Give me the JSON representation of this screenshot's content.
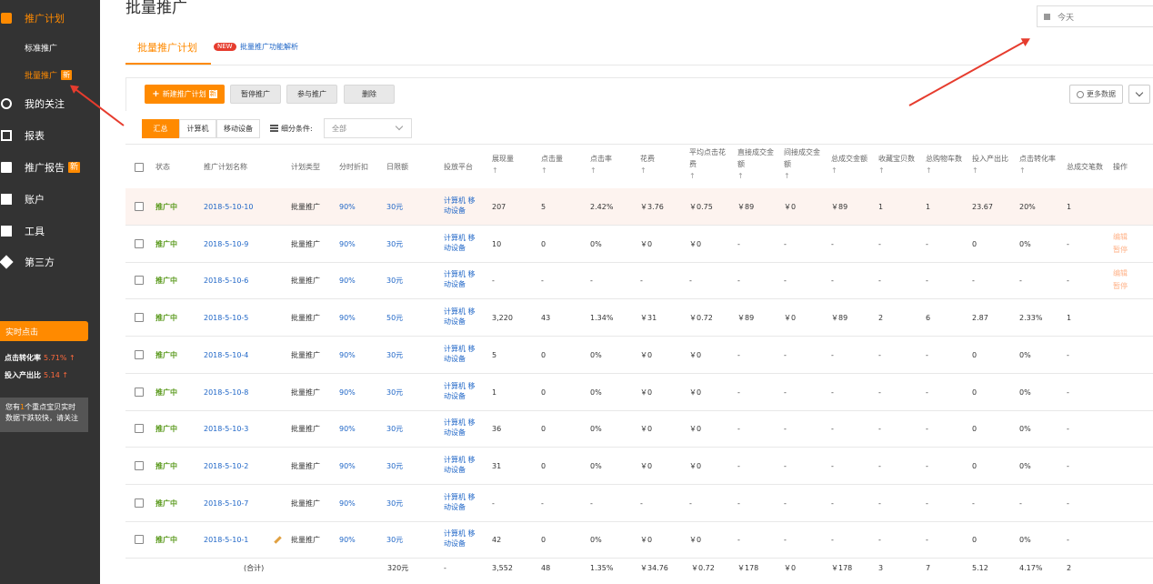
{
  "sidebar": {
    "items": [
      {
        "label": "推广计划",
        "icon": "briefcase-icon"
      },
      {
        "label": "我的关注",
        "icon": "heart-icon"
      },
      {
        "label": "报表",
        "icon": "report-icon"
      },
      {
        "label": "推广报告",
        "icon": "bag-icon",
        "badge": "新"
      },
      {
        "label": "账户",
        "icon": "id-card-icon"
      },
      {
        "label": "工具",
        "icon": "toolbox-icon"
      },
      {
        "label": "第三方",
        "icon": "diamond-icon"
      }
    ],
    "sub_items": [
      {
        "label": "标准推广"
      },
      {
        "label": "批量推广",
        "badge": "新"
      }
    ],
    "realtime": {
      "title": "实时点击",
      "ctr_label": "点击转化率",
      "ctr_value": "5.71% ↑",
      "roi_label": "投入产出比",
      "roi_value": "5.14 ↑",
      "note_prefix": "您有",
      "note_count": "1",
      "note_line1_suffix": "个重点宝贝实时",
      "note_line2": "数据下跌较快，请关注"
    }
  },
  "header": {
    "title": "批量推广",
    "date_value": "今天"
  },
  "tabs": {
    "plan": "批量推广计划",
    "new_tag": "NEW",
    "feature_link": "批量推广功能解析"
  },
  "toolbar": {
    "new_plan": "新建推广计划",
    "new_plan_badge": "新",
    "pause": "暂停推广",
    "join": "参与推广",
    "delete": "删除",
    "more_data": "更多数据"
  },
  "filters": {
    "segments": [
      "汇总",
      "计算机",
      "移动设备"
    ],
    "condition_label": "细分条件:",
    "condition_value": "全部"
  },
  "colors": {
    "accent": "#ff8a00",
    "link": "#1f66c7",
    "status": "#5b9a1e",
    "sidebar": "#333333"
  },
  "table": {
    "headers": [
      {
        "label": "状态"
      },
      {
        "label": "推广计划名称"
      },
      {
        "label": "计划类型"
      },
      {
        "label": "分时折扣"
      },
      {
        "label": "日限额"
      },
      {
        "label": "投放平台"
      },
      {
        "label": "展现量",
        "arrow": "↑"
      },
      {
        "label": "点击量",
        "arrow": "↑"
      },
      {
        "label": "点击率",
        "arrow": "↑"
      },
      {
        "label": "花费",
        "arrow": "↑"
      },
      {
        "label": "平均点击花",
        "label2": "费",
        "arrow": "↑"
      },
      {
        "label": "直接成交金",
        "label2": "额",
        "arrow": "↑"
      },
      {
        "label": "间接成交金",
        "label2": "额",
        "arrow": "↑"
      },
      {
        "label": "总成交金额",
        "arrow": "↑"
      },
      {
        "label": "收藏宝贝数",
        "arrow": "↑"
      },
      {
        "label": "总购物车数",
        "arrow": "↑"
      },
      {
        "label": "投入产出比",
        "arrow": "↑"
      },
      {
        "label": "点击转化率",
        "arrow": "↑"
      },
      {
        "label": "总成交笔数"
      },
      {
        "label": "操作"
      }
    ],
    "platform_line1": "计算机 移",
    "platform_line2": "动设备",
    "rows": [
      {
        "status": "推广中",
        "name": "2018-5-10-10",
        "type": "批量推广",
        "discount": "90%",
        "limit": "30元",
        "impr": "207",
        "clicks": "5",
        "ctr": "2.42%",
        "cost": "￥3.76",
        "cpc": "￥0.75",
        "direct": "￥89",
        "indirect": "￥0",
        "total_amt": "￥89",
        "fav": "1",
        "cart": "1",
        "roi": "23.67",
        "cvr": "20%",
        "orders": "1",
        "op1": "",
        "op2": "",
        "highlight": true
      },
      {
        "status": "推广中",
        "name": "2018-5-10-9",
        "type": "批量推广",
        "discount": "90%",
        "limit": "30元",
        "impr": "10",
        "clicks": "0",
        "ctr": "0%",
        "cost": "￥0",
        "cpc": "￥0",
        "direct": "-",
        "indirect": "-",
        "total_amt": "-",
        "fav": "-",
        "cart": "-",
        "roi": "0",
        "cvr": "0%",
        "orders": "-",
        "op1": "编辑",
        "op2": "暂停"
      },
      {
        "status": "推广中",
        "name": "2018-5-10-6",
        "type": "批量推广",
        "discount": "90%",
        "limit": "30元",
        "impr": "-",
        "clicks": "-",
        "ctr": "-",
        "cost": "-",
        "cpc": "-",
        "direct": "-",
        "indirect": "-",
        "total_amt": "-",
        "fav": "-",
        "cart": "-",
        "roi": "-",
        "cvr": "-",
        "orders": "-",
        "op1": "编辑",
        "op2": "暂停"
      },
      {
        "status": "推广中",
        "name": "2018-5-10-5",
        "type": "批量推广",
        "discount": "90%",
        "limit": "50元",
        "impr": "3,220",
        "clicks": "43",
        "ctr": "1.34%",
        "cost": "￥31",
        "cpc": "￥0.72",
        "direct": "￥89",
        "indirect": "￥0",
        "total_amt": "￥89",
        "fav": "2",
        "cart": "6",
        "roi": "2.87",
        "cvr": "2.33%",
        "orders": "1",
        "op1": "",
        "op2": ""
      },
      {
        "status": "推广中",
        "name": "2018-5-10-4",
        "type": "批量推广",
        "discount": "90%",
        "limit": "30元",
        "impr": "5",
        "clicks": "0",
        "ctr": "0%",
        "cost": "￥0",
        "cpc": "￥0",
        "direct": "-",
        "indirect": "-",
        "total_amt": "-",
        "fav": "-",
        "cart": "-",
        "roi": "0",
        "cvr": "0%",
        "orders": "-",
        "op1": "",
        "op2": ""
      },
      {
        "status": "推广中",
        "name": "2018-5-10-8",
        "type": "批量推广",
        "discount": "90%",
        "limit": "30元",
        "impr": "1",
        "clicks": "0",
        "ctr": "0%",
        "cost": "￥0",
        "cpc": "￥0",
        "direct": "-",
        "indirect": "-",
        "total_amt": "-",
        "fav": "-",
        "cart": "-",
        "roi": "0",
        "cvr": "0%",
        "orders": "-",
        "op1": "",
        "op2": ""
      },
      {
        "status": "推广中",
        "name": "2018-5-10-3",
        "type": "批量推广",
        "discount": "90%",
        "limit": "30元",
        "impr": "36",
        "clicks": "0",
        "ctr": "0%",
        "cost": "￥0",
        "cpc": "￥0",
        "direct": "-",
        "indirect": "-",
        "total_amt": "-",
        "fav": "-",
        "cart": "-",
        "roi": "0",
        "cvr": "0%",
        "orders": "-",
        "op1": "",
        "op2": ""
      },
      {
        "status": "推广中",
        "name": "2018-5-10-2",
        "type": "批量推广",
        "discount": "90%",
        "limit": "30元",
        "impr": "31",
        "clicks": "0",
        "ctr": "0%",
        "cost": "￥0",
        "cpc": "￥0",
        "direct": "-",
        "indirect": "-",
        "total_amt": "-",
        "fav": "-",
        "cart": "-",
        "roi": "0",
        "cvr": "0%",
        "orders": "-",
        "op1": "",
        "op2": ""
      },
      {
        "status": "推广中",
        "name": "2018-5-10-7",
        "type": "批量推广",
        "discount": "90%",
        "limit": "30元",
        "impr": "-",
        "clicks": "-",
        "ctr": "-",
        "cost": "-",
        "cpc": "-",
        "direct": "-",
        "indirect": "-",
        "total_amt": "-",
        "fav": "-",
        "cart": "-",
        "roi": "-",
        "cvr": "-",
        "orders": "-",
        "op1": "",
        "op2": ""
      },
      {
        "status": "推广中",
        "name": "2018-5-10-1",
        "type": "批量推广",
        "discount": "90%",
        "limit": "30元",
        "impr": "42",
        "clicks": "0",
        "ctr": "0%",
        "cost": "￥0",
        "cpc": "￥0",
        "direct": "-",
        "indirect": "-",
        "total_amt": "-",
        "fav": "-",
        "cart": "-",
        "roi": "0",
        "cvr": "0%",
        "orders": "-",
        "op1": "",
        "op2": "",
        "pencil": true
      }
    ],
    "total": {
      "label": "(合计)",
      "limit": "320元",
      "platform": "-",
      "impr": "3,552",
      "clicks": "48",
      "ctr": "1.35%",
      "cost": "￥34.76",
      "cpc": "￥0.72",
      "direct": "￥178",
      "indirect": "￥0",
      "total_amt": "￥178",
      "fav": "3",
      "cart": "7",
      "roi": "5.12",
      "cvr": "4.17%",
      "orders": "2"
    }
  }
}
